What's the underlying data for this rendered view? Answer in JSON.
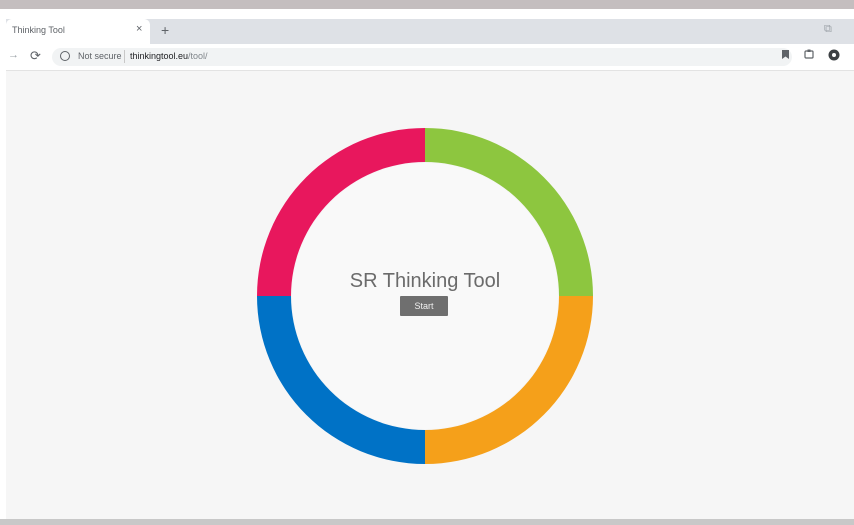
{
  "browser": {
    "tab_title": "Thinking Tool",
    "tab_close": "×",
    "new_tab": "+",
    "window_control": "⧉",
    "nav_forward": "→",
    "nav_reload": "⟳",
    "security_label": "Not secure",
    "url_host": "thinkingtool.eu",
    "url_path": "/tool/",
    "icons": [
      "bookmark-icon",
      "extension-icon",
      "profile-icon"
    ]
  },
  "app": {
    "title": "SR Thinking Tool",
    "start_label": "Start"
  },
  "colors": {
    "segment_top_left": "#e8175d",
    "segment_top_right": "#8dc63f",
    "segment_bottom_right": "#f5a01a",
    "segment_bottom_left": "#0072c6",
    "page_background": "#f6f6f6",
    "inner_circle": "#f9f9f9"
  }
}
